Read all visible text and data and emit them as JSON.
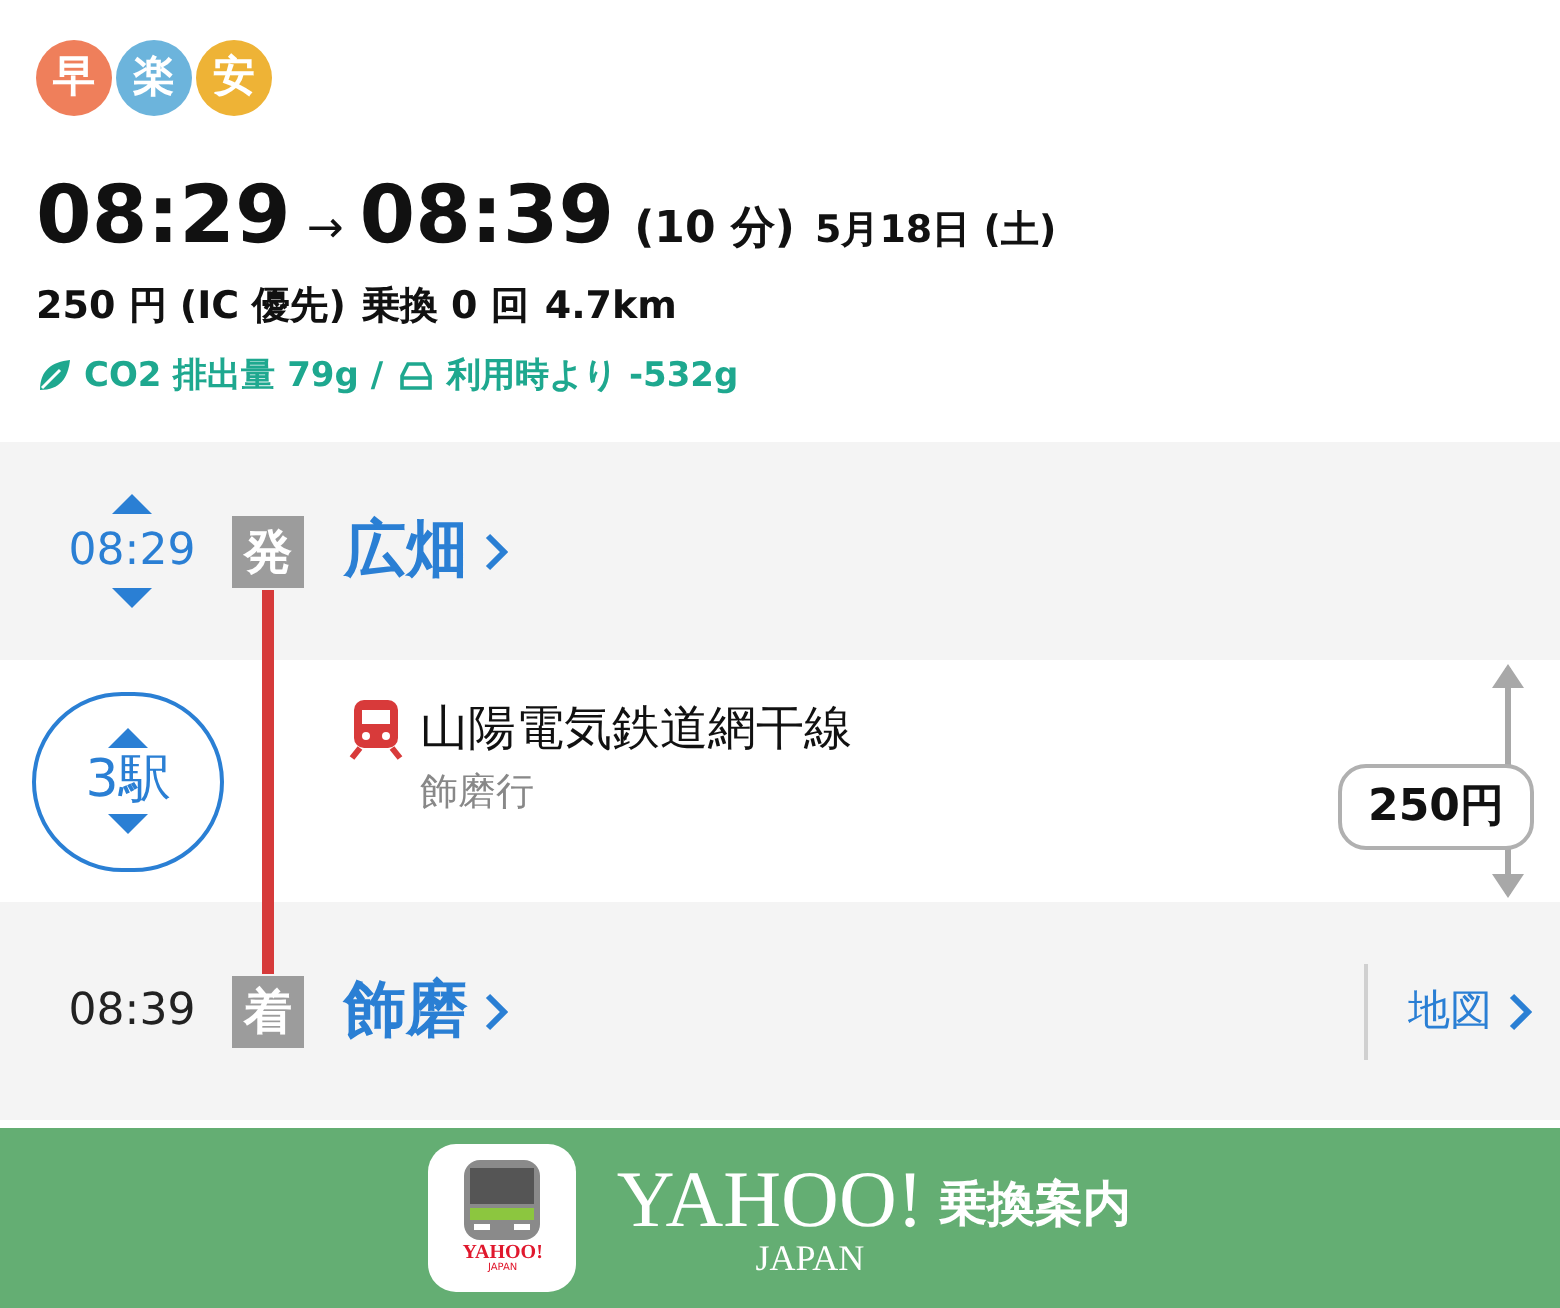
{
  "badges": [
    {
      "label": "早",
      "color": "#ef7f5b"
    },
    {
      "label": "楽",
      "color": "#6cb4dc"
    },
    {
      "label": "安",
      "color": "#eeb336"
    }
  ],
  "summary": {
    "depart": "08:29",
    "arrow": "→",
    "arrive": "08:39",
    "duration": "(10 分)",
    "date": "5月18日 (土)",
    "fare": "250 円 (IC 優先)",
    "transfers": "乗換 0 回",
    "distance": "4.7km",
    "co2": "CO2 排出量 79g /",
    "co2_compare": "利用時より -532g"
  },
  "route": {
    "departure": {
      "time": "08:29",
      "mark": "発",
      "station": "広畑"
    },
    "segment": {
      "stops": "3駅",
      "line": "山陽電気鉄道網干線",
      "destination": "飾磨行",
      "fare": "250円"
    },
    "arrival": {
      "time": "08:39",
      "mark": "着",
      "station": "飾磨",
      "map_link": "地図"
    }
  },
  "footer": {
    "app_icon_text": "YAHOO!",
    "app_icon_sub": "JAPAN",
    "logo": "YAHOO!",
    "logo_sub": "JAPAN",
    "service": "乗換案内"
  }
}
